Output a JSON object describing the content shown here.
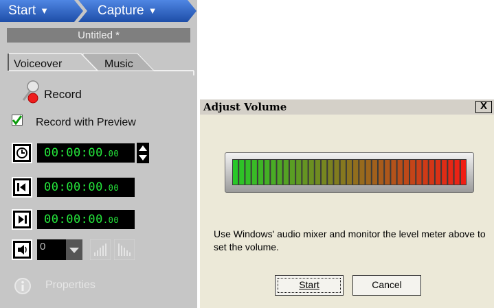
{
  "colors": {
    "breadcrumb": "#2a63c4",
    "lcd_text": "#25e83c",
    "panel_bg": "#c6c6c6",
    "dialog_bg": "#ece9d8"
  },
  "breadcrumb": {
    "start": "Start",
    "capture": "Capture",
    "caret": "▼"
  },
  "document": {
    "title": "Untitled *"
  },
  "tabs": {
    "voiceover": "Voiceover",
    "music": "Music",
    "active": "Voiceover"
  },
  "record": {
    "label": "Record",
    "preview_label": "Record with Preview",
    "preview_checked": true
  },
  "timecodes": {
    "duration": {
      "main": "00:00:00",
      "ms": ".00"
    },
    "mark_in": {
      "main": "00:00:00",
      "ms": ".00"
    },
    "mark_out": {
      "main": "00:00:00",
      "ms": ".00"
    }
  },
  "volume": {
    "value": "0"
  },
  "properties": {
    "label": "Properties"
  },
  "dialog": {
    "title": "Adjust Volume",
    "close": "X",
    "description": "Use Windows' audio mixer and monitor the level meter above to set the volume.",
    "start_button": "Start",
    "cancel_button": "Cancel",
    "meter_segments": 37
  },
  "icons": {
    "microphone": "microphone-icon",
    "clock": "clock-icon",
    "mark_in": "mark-in-icon",
    "mark_out": "mark-out-icon",
    "speaker": "speaker-icon",
    "info": "info-icon"
  }
}
